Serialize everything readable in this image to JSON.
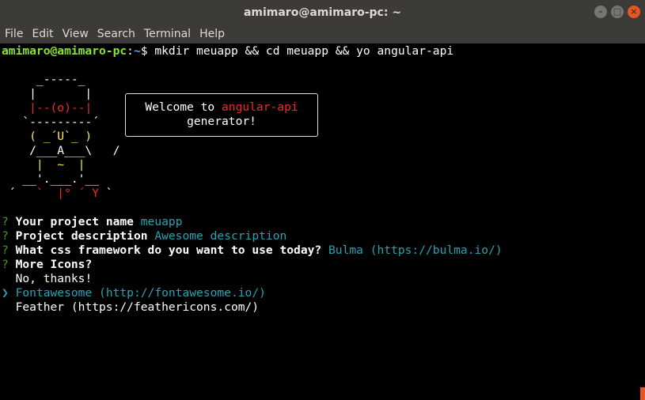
{
  "window": {
    "title": "amimaro@amimaro-pc: ~",
    "controls": {
      "minimize": "–",
      "maximize": "□",
      "close": "×"
    }
  },
  "menu": [
    "File",
    "Edit",
    "View",
    "Search",
    "Terminal",
    "Help"
  ],
  "prompt": {
    "user_host": "amimaro@amimaro-pc",
    "sep": ":",
    "path": "~",
    "dollar": "$",
    "command": " mkdir meuapp && cd meuapp && yo angular-api"
  },
  "ascii": {
    "l1": "     _-----_",
    "l2a": "    |       |",
    "l3a": "    ",
    "l3b": "|--(o)--|",
    "l4": "   `---------´",
    "l5": "    ( _´U`_ )",
    "l6": "    /___A___\\   /",
    "l7": "     |  ~  |",
    "l8a": "   __'.___.'__",
    "l9a": " ´   ",
    "l9b": "`  |° ´ Y",
    "l9c": " `"
  },
  "welcome": {
    "prefix": "Welcome to ",
    "name": "angular-api",
    "line2": "generator!"
  },
  "questions": [
    {
      "mark": "?",
      "label": "Your project name",
      "answer": "meuapp"
    },
    {
      "mark": "?",
      "label": "Project description",
      "answer": "Awesome description"
    },
    {
      "mark": "?",
      "label": "What css framework do you want to use today?",
      "answer": "Bulma (https://bulma.io/)"
    },
    {
      "mark": "?",
      "label": "More Icons?",
      "answer": ""
    }
  ],
  "choices": {
    "pointer": "❯",
    "items": [
      "No, thanks!",
      "Fontawesome (http://fontawesome.io/)",
      "Feather (https://feathericons.com/)"
    ],
    "selected_index": 1
  },
  "colors": {
    "user_host": "#8ae234",
    "path": "#729fcf",
    "answer": "#2aa1b3",
    "highlight": "#ef2929",
    "accent": "#e95420"
  }
}
